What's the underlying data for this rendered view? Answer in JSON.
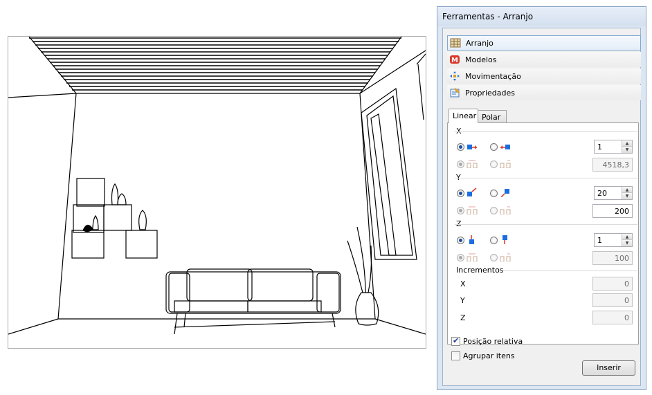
{
  "window": {
    "title": "Ferramentas - Arranjo",
    "nav": [
      {
        "label": "Arranjo",
        "icon": "arrangement-icon",
        "active": true
      },
      {
        "label": "Modelos",
        "icon": "models-icon",
        "active": false
      },
      {
        "label": "Movimentação",
        "icon": "move-icon",
        "active": false
      },
      {
        "label": "Propriedades",
        "icon": "properties-icon",
        "active": false
      }
    ]
  },
  "tabs": [
    "Linear",
    "Polar"
  ],
  "axes": [
    {
      "label": "X",
      "count": "1",
      "distance": "4518,3",
      "distance_enabled": false,
      "direction": "positive"
    },
    {
      "label": "Y",
      "count": "20",
      "distance": "200",
      "distance_enabled": true,
      "direction": "positive"
    },
    {
      "label": "Z",
      "count": "1",
      "distance": "100",
      "distance_enabled": false,
      "direction": "positive"
    }
  ],
  "increments": {
    "title": "Incrementos",
    "rows": [
      {
        "label": "X",
        "value": "0"
      },
      {
        "label": "Y",
        "value": "0"
      },
      {
        "label": "Z",
        "value": "0"
      }
    ]
  },
  "options": {
    "relative_position": {
      "label": "Posição relativa",
      "checked": true
    },
    "group_items": {
      "label": "Agrupar itens",
      "checked": false
    }
  },
  "insert_button": "Inserir",
  "colors": {
    "panel_bg": "#dce7f3",
    "accent_blue": "#1c6ee0",
    "accent_red": "#d9382a",
    "active_border": "#7ea9d6"
  }
}
